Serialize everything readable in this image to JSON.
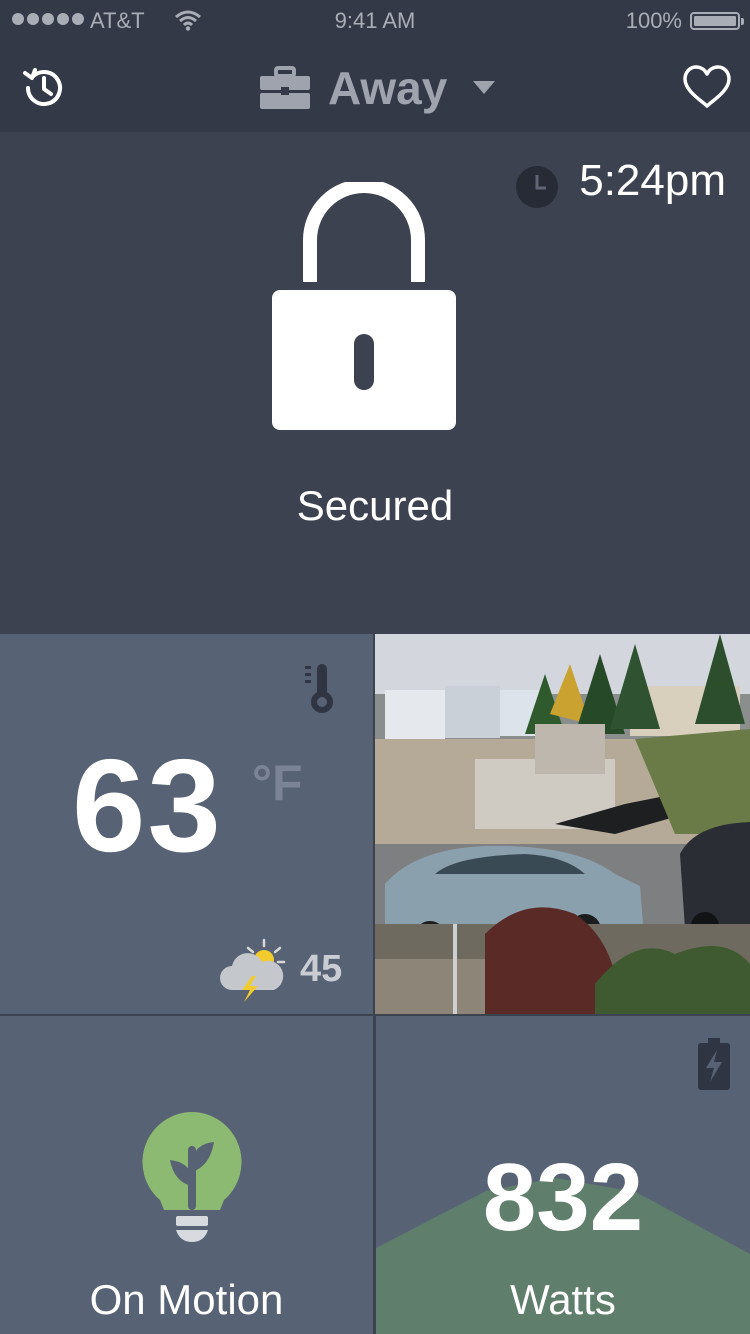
{
  "status_bar": {
    "carrier": "AT&T",
    "time": "9:41 AM",
    "battery_percent": "100%",
    "icons": [
      "signal-dots",
      "wifi-icon",
      "battery-icon"
    ]
  },
  "nav": {
    "mode_label": "Away",
    "icons": [
      "history-icon",
      "briefcase-icon",
      "chevron-down-icon",
      "heart-icon"
    ]
  },
  "security": {
    "updated_time": "5:24pm",
    "status_label": "Secured",
    "status_color": "#b7e57c",
    "icons": [
      "clock-icon",
      "padlock-icon"
    ]
  },
  "thermostat": {
    "temperature": "63",
    "unit": "°F",
    "outdoor_temperature": "45",
    "icons": [
      "thermometer-icon",
      "thunderstorm-icon"
    ]
  },
  "camera": {
    "icons": [
      "camera-feed"
    ]
  },
  "lighting": {
    "label": "On Motion",
    "accent_color": "#8dba72",
    "icons": [
      "leaf-bulb-icon"
    ]
  },
  "energy": {
    "value": "832",
    "label": "Watts",
    "accent_color": "#5f7e6b",
    "icons": [
      "battery-charging-icon"
    ]
  },
  "colors": {
    "header_bg": "#333946",
    "panel_bg": "#3c4250",
    "tile_bg": "#576274"
  }
}
